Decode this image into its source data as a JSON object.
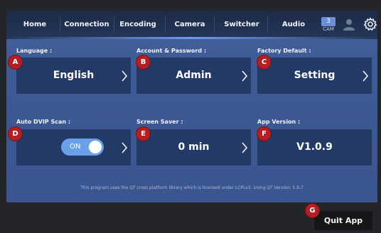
{
  "nav": {
    "tabs": [
      "Home",
      "Connection",
      "Encoding",
      "Camera",
      "Switcher",
      "Audio"
    ],
    "cam_number": "3",
    "cam_label": "CAM"
  },
  "settings": {
    "language": {
      "label": "Language :",
      "value": "English",
      "badge": "A"
    },
    "account": {
      "label": "Account & Password :",
      "value": "Admin",
      "badge": "B"
    },
    "factory": {
      "label": "Factory Default :",
      "value": "Setting",
      "badge": "C"
    },
    "dvip": {
      "label": "Auto DVIP Scan :",
      "toggle_text": "ON",
      "toggle_state": "on",
      "badge": "D"
    },
    "screensaver": {
      "label": "Screen Saver :",
      "value": "0 min",
      "badge": "E"
    },
    "version": {
      "label": "App Version :",
      "value": "V1.0.9",
      "badge": "F"
    }
  },
  "footer": {
    "note": "This program uses the QT cross platform library which is licensed under LCPLv3. Using QT Version: 5.9.7"
  },
  "quit": {
    "label": "Quit App",
    "badge": "G"
  },
  "colors": {
    "accent": "#6aa0e8",
    "badge": "#b41f24",
    "card": "#243a66",
    "panel": "#3e5a94"
  },
  "icons": [
    "user-icon",
    "gear-icon",
    "chevron-right-icon"
  ]
}
